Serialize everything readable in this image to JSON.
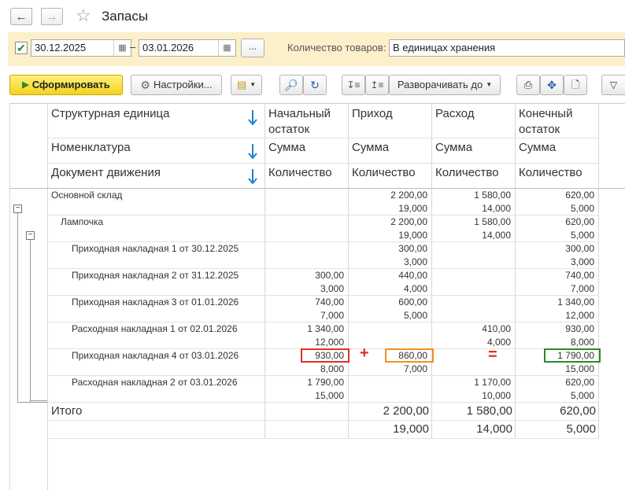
{
  "window": {
    "title": "Запасы"
  },
  "params": {
    "period_enabled": true,
    "date_from": "30.12.2025",
    "dash": "–",
    "date_to": "03.01.2026",
    "more_label": "...",
    "qty_label": "Количество товаров:",
    "qty_value": "В единицах хранения"
  },
  "toolbar": {
    "generate_label": "Сформировать",
    "settings_label": "Настройки...",
    "expand_label": "Разворачивать до"
  },
  "columns": {
    "dims": [
      "Структурная единица",
      "Номенклатура",
      "Документ движения"
    ],
    "start": {
      "line1": "Начальный",
      "line2": "остаток"
    },
    "income": "Приход",
    "expense": "Расход",
    "end": {
      "line1": "Конечный",
      "line2": "остаток"
    },
    "sum": "Сумма",
    "qty": "Количество"
  },
  "rows": [
    {
      "label": "Основной склад",
      "start_sum": "",
      "start_qty": "",
      "in_sum": "2 200,00",
      "in_qty": "19,000",
      "out_sum": "1 580,00",
      "out_qty": "14,000",
      "end_sum": "620,00",
      "end_qty": "5,000"
    },
    {
      "label": "Лампочка",
      "start_sum": "",
      "start_qty": "",
      "in_sum": "2 200,00",
      "in_qty": "19,000",
      "out_sum": "1 580,00",
      "out_qty": "14,000",
      "end_sum": "620,00",
      "end_qty": "5,000"
    },
    {
      "label": "Приходная накладная 1 от 30.12.2025",
      "start_sum": "",
      "start_qty": "",
      "in_sum": "300,00",
      "in_qty": "3,000",
      "out_sum": "",
      "out_qty": "",
      "end_sum": "300,00",
      "end_qty": "3,000"
    },
    {
      "label": "Приходная накладная 2 от 31.12.2025",
      "start_sum": "300,00",
      "start_qty": "3,000",
      "in_sum": "440,00",
      "in_qty": "4,000",
      "out_sum": "",
      "out_qty": "",
      "end_sum": "740,00",
      "end_qty": "7,000"
    },
    {
      "label": "Приходная накладная 3 от 01.01.2026",
      "start_sum": "740,00",
      "start_qty": "7,000",
      "in_sum": "600,00",
      "in_qty": "5,000",
      "out_sum": "",
      "out_qty": "",
      "end_sum": "1 340,00",
      "end_qty": "12,000"
    },
    {
      "label": "Расходная накладная 1 от 02.01.2026",
      "start_sum": "1 340,00",
      "start_qty": "12,000",
      "in_sum": "",
      "in_qty": "",
      "out_sum": "410,00",
      "out_qty": "4,000",
      "end_sum": "930,00",
      "end_qty": "8,000"
    },
    {
      "label": "Приходная накладная 4 от 03.01.2026",
      "start_sum": "930,00",
      "start_qty": "8,000",
      "in_sum": "860,00",
      "in_qty": "7,000",
      "out_sum": "",
      "out_qty": "",
      "end_sum": "1 790,00",
      "end_qty": "15,000"
    },
    {
      "label": "Расходная накладная 2 от 03.01.2026",
      "start_sum": "1 790,00",
      "start_qty": "15,000",
      "in_sum": "",
      "in_qty": "",
      "out_sum": "1 170,00",
      "out_qty": "10,000",
      "end_sum": "620,00",
      "end_qty": "5,000"
    }
  ],
  "totals": {
    "label": "Итого",
    "start_sum": "",
    "start_qty": "",
    "in_sum": "2 200,00",
    "in_qty": "19,000",
    "out_sum": "1 580,00",
    "out_qty": "14,000",
    "end_sum": "620,00",
    "end_qty": "5,000"
  },
  "annotations": {
    "plus": "+",
    "equals": "=",
    "colors": {
      "start": "#e0302a",
      "income": "#f0901e",
      "end": "#2a8a2a"
    }
  },
  "icons": [
    "back-arrow-icon",
    "forward-arrow-icon",
    "star-icon",
    "check-icon",
    "calendar-icon",
    "play-icon",
    "gear-icon",
    "variants-icon",
    "search-icon",
    "search-refresh-icon",
    "sort-desc-icon",
    "sort-asc-icon",
    "dropdown-caret-icon",
    "print-icon",
    "move-icon",
    "preview-icon",
    "filter-icon",
    "tree-collapse-icon",
    "sort-arrow-icon"
  ]
}
